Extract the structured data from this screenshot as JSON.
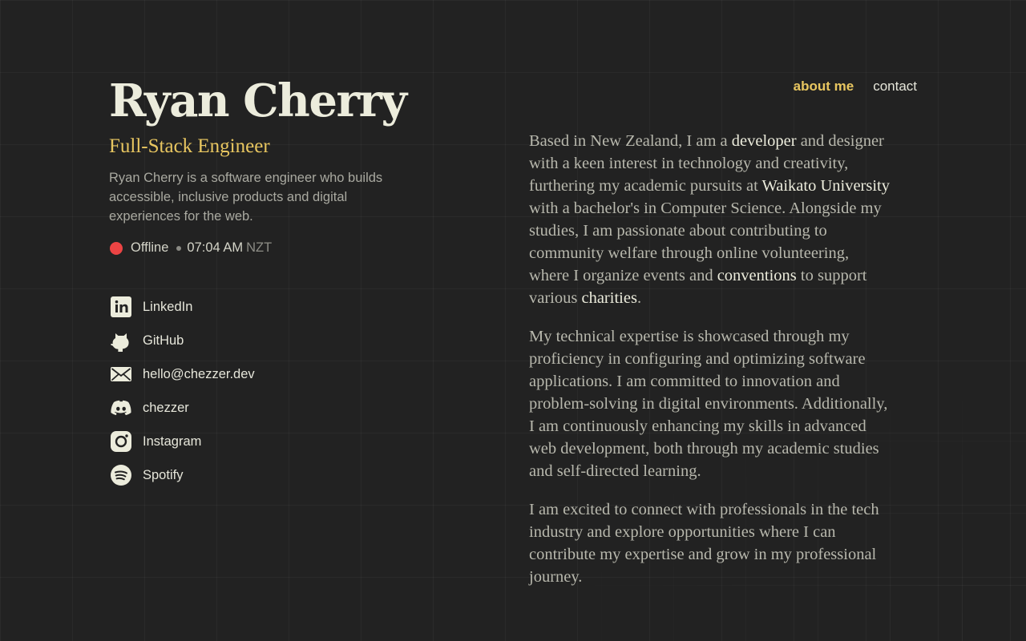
{
  "profile": {
    "name": "Ryan Cherry",
    "role": "Full-Stack Engineer",
    "bio": "Ryan Cherry is a software engineer who builds accessible, inclusive products and digital experiences for the web."
  },
  "status": {
    "state": "Offline",
    "time": "07:04 AM",
    "timezone": "NZT",
    "color": "#ec4444"
  },
  "links": [
    {
      "label": "LinkedIn",
      "icon": "linkedin-icon"
    },
    {
      "label": "GitHub",
      "icon": "github-icon"
    },
    {
      "label": "hello@chezzer.dev",
      "icon": "mail-icon"
    },
    {
      "label": "chezzer",
      "icon": "discord-icon"
    },
    {
      "label": "Instagram",
      "icon": "instagram-icon"
    },
    {
      "label": "Spotify",
      "icon": "spotify-icon"
    }
  ],
  "nav": {
    "about": "about me",
    "contact": "contact"
  },
  "about": {
    "p1": {
      "s1": "Based in New Zealand, I am a ",
      "h1": "developer",
      "s2": " and designer with a keen interest in technology and creativity, furthering my academic pursuits at ",
      "h2": "Waikato University",
      "s3": " with a bachelor's in Computer Science. Alongside my studies, I am passionate about contributing to community welfare through online volunteering, where I organize events and ",
      "h3": "conventions",
      "s4": " to support various ",
      "h4": "charities",
      "s5": "."
    },
    "p2": "My technical expertise is showcased through my proficiency in configuring and optimizing software applications. I am committed to innovation and problem-solving in digital environments. Additionally, I am continuously enhancing my skills in advanced web development, both through my academic studies and self-directed learning.",
    "p3": "I am excited to connect with professionals in the tech industry and explore opportunities where I can contribute my expertise and grow in my professional journey."
  },
  "colors": {
    "background": "#222222",
    "accent": "#e8c660",
    "text": "#ececdc",
    "muted": "#a9a9a0"
  }
}
